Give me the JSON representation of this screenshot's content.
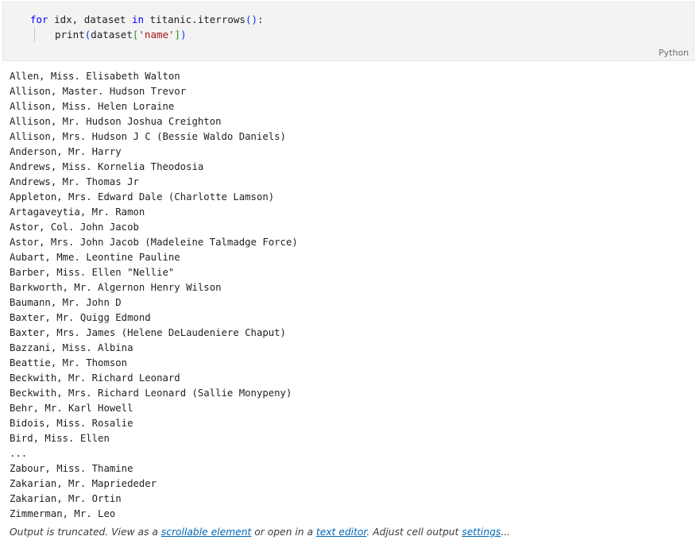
{
  "code_cell": {
    "line1": {
      "kw_for": "for",
      "vars": " idx, dataset ",
      "kw_in": "in",
      "expr": " titanic.iterrows",
      "parens": "()",
      "colon": ":"
    },
    "line2": {
      "func": "print",
      "open": "(",
      "arg": "dataset",
      "bracket_open": "[",
      "str": "'name'",
      "bracket_close": "]",
      "close": ")"
    },
    "language": "Python"
  },
  "output": {
    "lines": [
      "Allen, Miss. Elisabeth Walton",
      "Allison, Master. Hudson Trevor",
      "Allison, Miss. Helen Loraine",
      "Allison, Mr. Hudson Joshua Creighton",
      "Allison, Mrs. Hudson J C (Bessie Waldo Daniels)",
      "Anderson, Mr. Harry",
      "Andrews, Miss. Kornelia Theodosia",
      "Andrews, Mr. Thomas Jr",
      "Appleton, Mrs. Edward Dale (Charlotte Lamson)",
      "Artagaveytia, Mr. Ramon",
      "Astor, Col. John Jacob",
      "Astor, Mrs. John Jacob (Madeleine Talmadge Force)",
      "Aubart, Mme. Leontine Pauline",
      "Barber, Miss. Ellen \"Nellie\"",
      "Barkworth, Mr. Algernon Henry Wilson",
      "Baumann, Mr. John D",
      "Baxter, Mr. Quigg Edmond",
      "Baxter, Mrs. James (Helene DeLaudeniere Chaput)",
      "Bazzani, Miss. Albina",
      "Beattie, Mr. Thomson",
      "Beckwith, Mr. Richard Leonard",
      "Beckwith, Mrs. Richard Leonard (Sallie Monypeny)",
      "Behr, Mr. Karl Howell",
      "Bidois, Miss. Rosalie",
      "Bird, Miss. Ellen",
      "...",
      "Zabour, Miss. Thamine",
      "Zakarian, Mr. Mapriededer",
      "Zakarian, Mr. Ortin",
      "Zimmerman, Mr. Leo"
    ]
  },
  "truncation": {
    "prefix": "Output is truncated. View as a ",
    "link_scrollable": "scrollable element",
    "middle": " or open in a ",
    "link_editor": "text editor",
    "after_editor": ". Adjust cell output ",
    "link_settings": "settings",
    "suffix": "..."
  },
  "colors": {
    "keyword": "#0000ff",
    "string": "#a31515",
    "link": "#0067b8",
    "cell_background": "#f3f3f3"
  }
}
